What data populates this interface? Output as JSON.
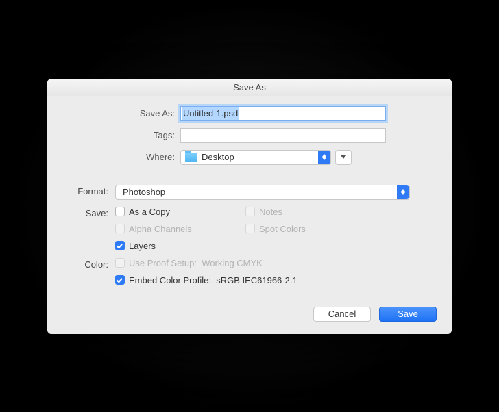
{
  "dialog": {
    "title": "Save As",
    "saveas_label": "Save As:",
    "filename": "Untitled-1.psd",
    "tags_label": "Tags:",
    "tags_value": "",
    "where_label": "Where:",
    "where_value": "Desktop"
  },
  "format": {
    "label": "Format:",
    "value": "Photoshop"
  },
  "save": {
    "label": "Save:",
    "as_a_copy": "As a Copy",
    "notes": "Notes",
    "alpha_channels": "Alpha Channels",
    "spot_colors": "Spot Colors",
    "layers": "Layers"
  },
  "color": {
    "label": "Color:",
    "use_proof_setup": "Use Proof Setup:",
    "use_proof_value": "Working CMYK",
    "embed_profile": "Embed Color Profile:",
    "embed_profile_value": "sRGB IEC61966-2.1"
  },
  "buttons": {
    "cancel": "Cancel",
    "save": "Save"
  }
}
